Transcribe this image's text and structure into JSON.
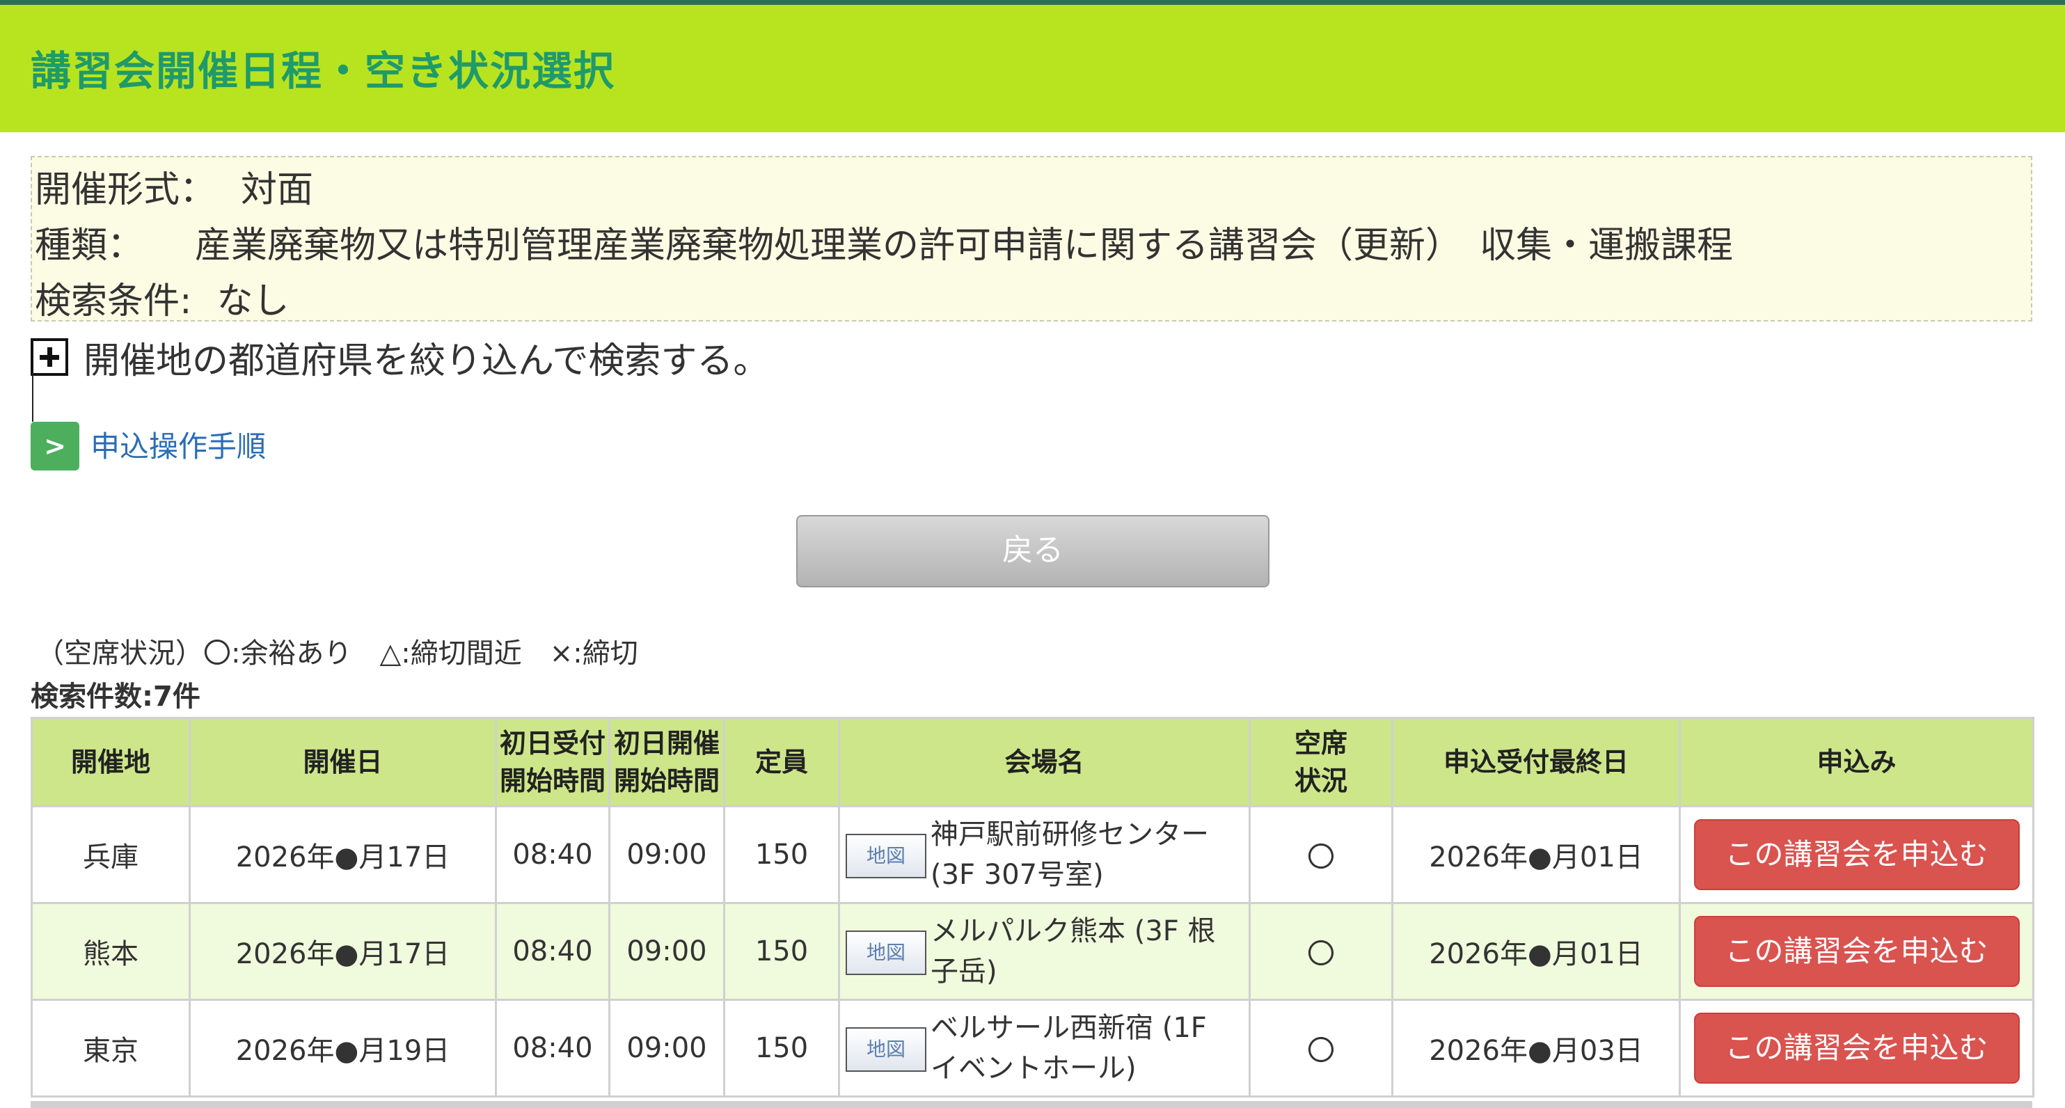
{
  "header": {
    "title": "講習会開催日程・空き状況選択"
  },
  "info": {
    "format_label": "開催形式：",
    "format_value": "対面",
    "type_label": "種類：",
    "type_value": "産業廃棄物又は特別管理産業廃棄物処理業の許可申請に関する講習会（更新）　収集・運搬課程",
    "search_label": "検索条件:",
    "search_value": "なし"
  },
  "refine": {
    "text": "開催地の都道府県を絞り込んで検索する。"
  },
  "procedure": {
    "icon": ">",
    "link": "申込操作手順"
  },
  "back_button": "戻る",
  "legend": "（空席状況）〇:余裕あり　△:締切間近　×:締切",
  "result_count": "検索件数:7件",
  "table": {
    "headers": {
      "location": "開催地",
      "date": "開催日",
      "reception_1": "初日受付",
      "reception_2": "開始時間",
      "start_1": "初日開催",
      "start_2": "開始時間",
      "capacity": "定員",
      "venue": "会場名",
      "availability_1": "空席",
      "availability_2": "状況",
      "deadline": "申込受付最終日",
      "apply": "申込み"
    },
    "rows": [
      {
        "location": "兵庫",
        "date": "2026年●月17日",
        "reception": "08:40",
        "start": "09:00",
        "capacity": "150",
        "map": "地図",
        "venue": "神戸駅前研修センター(3F 307号室)",
        "availability": "〇",
        "deadline": "2026年●月01日",
        "apply": "この講習会を申込む"
      },
      {
        "location": "熊本",
        "date": "2026年●月17日",
        "reception": "08:40",
        "start": "09:00",
        "capacity": "150",
        "map": "地図",
        "venue": "メルパルク熊本 (3F 根子岳)",
        "availability": "〇",
        "deadline": "2026年●月01日",
        "apply": "この講習会を申込む"
      },
      {
        "location": "東京",
        "date": "2026年●月19日",
        "reception": "08:40",
        "start": "09:00",
        "capacity": "150",
        "map": "地図",
        "venue": "ベルサール西新宿 (1F イベントホール)",
        "availability": "〇",
        "deadline": "2026年●月03日",
        "apply": "この講習会を申込む"
      }
    ]
  },
  "colors": {
    "header_bg": "#b8e41f",
    "header_text": "#1f9a6a",
    "info_bg": "#fcfce4",
    "table_header_bg": "#cde68a",
    "row_alt_bg": "#f0fadc",
    "apply_button": "#d9534f",
    "link": "#2b6db5",
    "procedure_icon": "#4daf5d"
  },
  "icons": {
    "expand": "plus-square-icon",
    "procedure": "chevron-right-icon"
  }
}
